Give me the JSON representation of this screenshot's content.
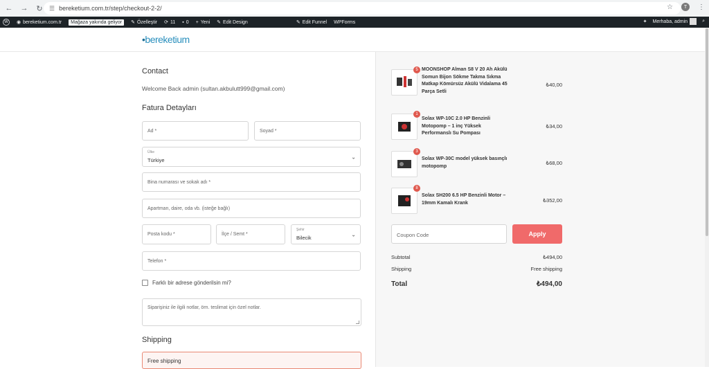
{
  "browser": {
    "url": "bereketium.com.tr/step/checkout-2-2/",
    "avatar_letter": "T"
  },
  "adminbar": {
    "site": "bereketium.com.tr",
    "coming_soon": "Mağaza yakında geliyor",
    "customize": "Özelleştir",
    "updates": "11",
    "comments": "0",
    "new": "Yeni",
    "edit_design": "Edit Design",
    "edit_funnel": "Edit Funnel",
    "wpforms": "WPForms",
    "greeting": "Merhaba, admin"
  },
  "logo": {
    "prefix": "•",
    "text": "bereketium"
  },
  "contact": {
    "heading": "Contact",
    "welcome": "Welcome Back admin (sultan.akbulutt999@gmail.com)"
  },
  "billing": {
    "heading": "Fatura Detayları",
    "first_name": "Ad *",
    "last_name": "Soyad *",
    "country_label": "Ülke",
    "country_value": "Türkiye",
    "street": "Bina numarası ve sokak adı *",
    "apartment": "Apartman, daire, oda vb. (isteğe bağlı)",
    "postcode": "Posta kodu *",
    "district": "İlçe / Semt *",
    "city_label": "Şehir",
    "city_value": "Bilecik",
    "phone": "Telefon *",
    "ship_different": "Farklı bir adrese gönderilsin mi?",
    "notes": "Siparişiniz ile ilgili notlar, örn. teslimat için özel notlar."
  },
  "shipping": {
    "heading": "Shipping",
    "option": "Free shipping"
  },
  "order": {
    "products": [
      {
        "qty": "5",
        "name": "MOONSHOP Alman S8 V 20 Ah Akülü Somun Bijon Sökme Takma Sıkma Matkap Kömürsüz Akülü Vidalama 45 Parça Setli",
        "price": "₺40,00"
      },
      {
        "qty": "1",
        "name": "Solax WP-10C 2.0 HP Benzinli Motopomp – 1 inç Yüksek Performanslı Su Pompası",
        "price": "₺34,00"
      },
      {
        "qty": "3",
        "name": "Solax WP-30C model yüksek basınçlı motopomp",
        "price": "₺68,00"
      },
      {
        "qty": "8",
        "name": "Solax SH200 6.5 HP Benzinli Motor – 19mm Kamalı Krank",
        "price": "₺352,00"
      }
    ],
    "coupon_placeholder": "Coupon Code",
    "apply_label": "Apply",
    "subtotal_label": "Subtotal",
    "subtotal_value": "₺494,00",
    "shipping_label": "Shipping",
    "shipping_value": "Free shipping",
    "total_label": "Total",
    "total_value": "₺494,00"
  },
  "colors": {
    "accent": "#f06a6a",
    "logo": "#2a8fbd",
    "adminbar": "#1d2327"
  }
}
